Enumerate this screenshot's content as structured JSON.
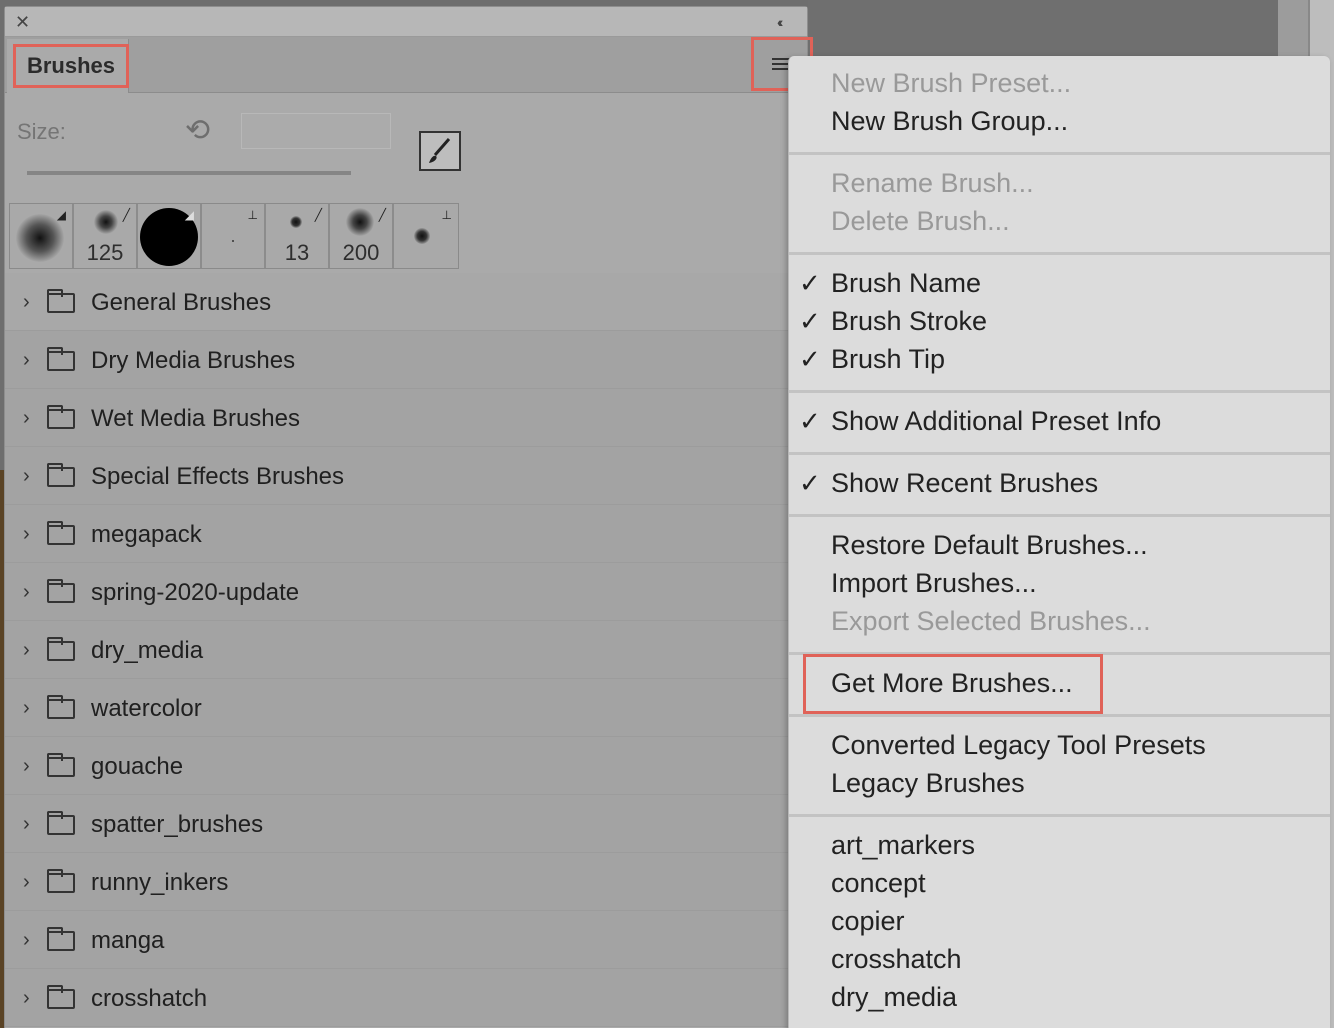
{
  "panel": {
    "close_glyph": "✕",
    "collapse_glyph": "‹‹",
    "tab_label": "Brushes",
    "size_label": "Size:",
    "reset_glyph": "⟲",
    "recent_brushes": [
      {
        "size": "",
        "tool": "eraser-icon"
      },
      {
        "size": "125",
        "tool": "brush-icon"
      },
      {
        "size": "",
        "tool": "eraser-icon"
      },
      {
        "size": "",
        "tool": "stamp-icon"
      },
      {
        "size": "13",
        "tool": "brush-icon"
      },
      {
        "size": "200",
        "tool": "brush-icon"
      },
      {
        "size": "",
        "tool": "stamp-icon"
      }
    ],
    "groups": [
      "General Brushes",
      "Dry Media Brushes",
      "Wet Media Brushes",
      "Special Effects Brushes",
      "megapack",
      "spring-2020-update",
      "dry_media",
      "watercolor",
      "gouache",
      "spatter_brushes",
      "runny_inkers",
      "manga",
      "crosshatch"
    ],
    "chevron_glyph": "›"
  },
  "menu": {
    "check_glyph": "✓",
    "new_brush_preset": "New Brush Preset...",
    "new_brush_group": "New Brush Group...",
    "rename_brush": "Rename Brush...",
    "delete_brush": "Delete Brush...",
    "brush_name": "Brush Name",
    "brush_stroke": "Brush Stroke",
    "brush_tip": "Brush Tip",
    "show_additional": "Show Additional Preset Info",
    "show_recent": "Show Recent Brushes",
    "restore_default": "Restore Default Brushes...",
    "import_brushes": "Import Brushes...",
    "export_selected": "Export Selected Brushes...",
    "get_more": "Get More Brushes...",
    "converted_legacy": "Converted Legacy Tool Presets",
    "legacy_brushes": "Legacy Brushes",
    "library_items": [
      "art_markers",
      "concept",
      "copier",
      "crosshatch",
      "dry_media"
    ]
  },
  "colors": {
    "highlight": "#e06258",
    "panel_bg": "#aaaaaa",
    "menu_bg": "#dcdcdc"
  }
}
